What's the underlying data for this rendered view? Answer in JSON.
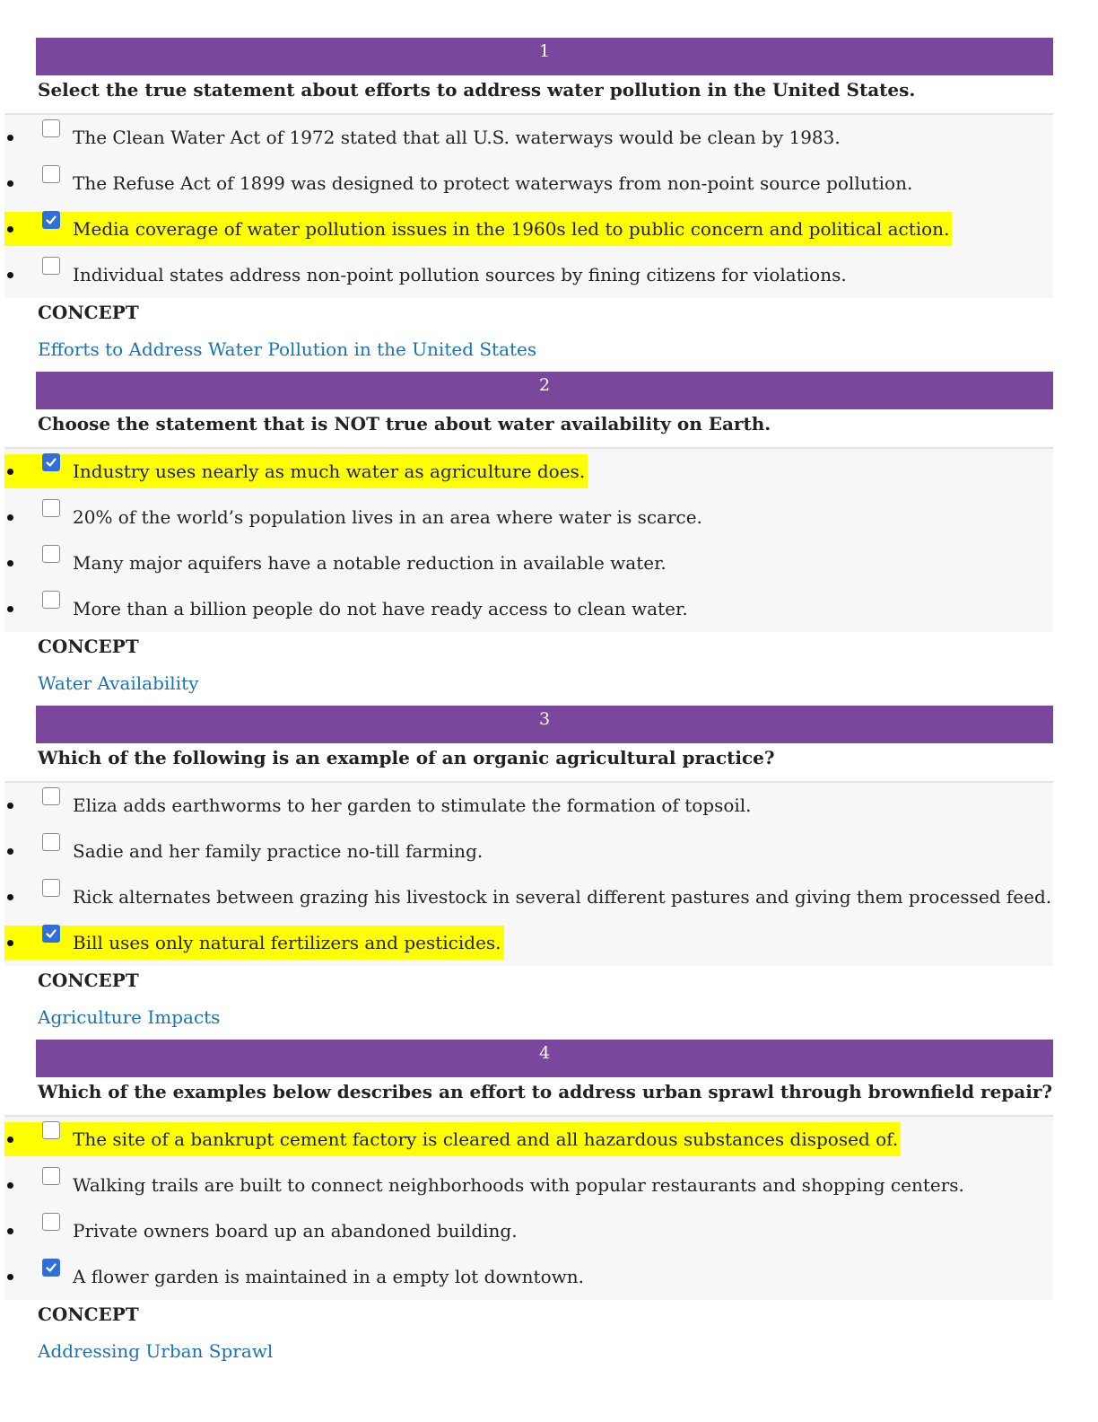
{
  "concept_label": "CONCEPT",
  "questions": [
    {
      "number": "1",
      "prompt": "Select the true statement about efforts to address water pollution in the United States.",
      "options": [
        {
          "text": "The Clean Water Act of 1972 stated that all U.S. waterways would be clean by 1983.",
          "checked": false,
          "highlighted": false
        },
        {
          "text": "The Refuse Act of 1899 was designed to protect waterways from non-point source pollution.",
          "checked": false,
          "highlighted": false
        },
        {
          "text": "Media coverage of water pollution issues in the 1960s led to public concern and political action.",
          "checked": true,
          "highlighted": true
        },
        {
          "text": "Individual states address non-point pollution sources by fining citizens for violations.",
          "checked": false,
          "highlighted": false
        }
      ],
      "concept": "Efforts to Address Water Pollution in the United States"
    },
    {
      "number": "2",
      "prompt": "Choose the statement that is NOT true about water availability on Earth.",
      "options": [
        {
          "text": "Industry uses nearly as much water as agriculture does.",
          "checked": true,
          "highlighted": true
        },
        {
          "text": "20% of the world’s population lives in an area where water is scarce.",
          "checked": false,
          "highlighted": false
        },
        {
          "text": "Many major aquifers have a notable reduction in available water.",
          "checked": false,
          "highlighted": false
        },
        {
          "text": "More than a billion people do not have ready access to clean water.",
          "checked": false,
          "highlighted": false
        }
      ],
      "concept": "Water Availability"
    },
    {
      "number": "3",
      "prompt": "Which of the following is an example of an organic agricultural practice?",
      "options": [
        {
          "text": "Eliza adds earthworms to her garden to stimulate the formation of topsoil.",
          "checked": false,
          "highlighted": false
        },
        {
          "text": "Sadie and her family practice no-till farming.",
          "checked": false,
          "highlighted": false
        },
        {
          "text": "Rick alternates between grazing his livestock in several different pastures and giving them processed feed.",
          "checked": false,
          "highlighted": false
        },
        {
          "text": "Bill uses only natural fertilizers and pesticides.",
          "checked": true,
          "highlighted": true
        }
      ],
      "concept": "Agriculture Impacts"
    },
    {
      "number": "4",
      "prompt": "Which of the examples below describes an effort to address urban sprawl through brownfield repair?",
      "options": [
        {
          "text": "The site of a bankrupt cement factory is cleared and all hazardous substances disposed of.",
          "checked": false,
          "highlighted": true
        },
        {
          "text": "Walking trails are built to connect neighborhoods with popular restaurants and shopping centers.",
          "checked": false,
          "highlighted": false
        },
        {
          "text": "Private owners board up an abandoned building.",
          "checked": false,
          "highlighted": false
        },
        {
          "text": "A flower garden is maintained in a empty lot downtown.",
          "checked": true,
          "highlighted": false
        }
      ],
      "concept": "Addressing Urban Sprawl"
    }
  ]
}
